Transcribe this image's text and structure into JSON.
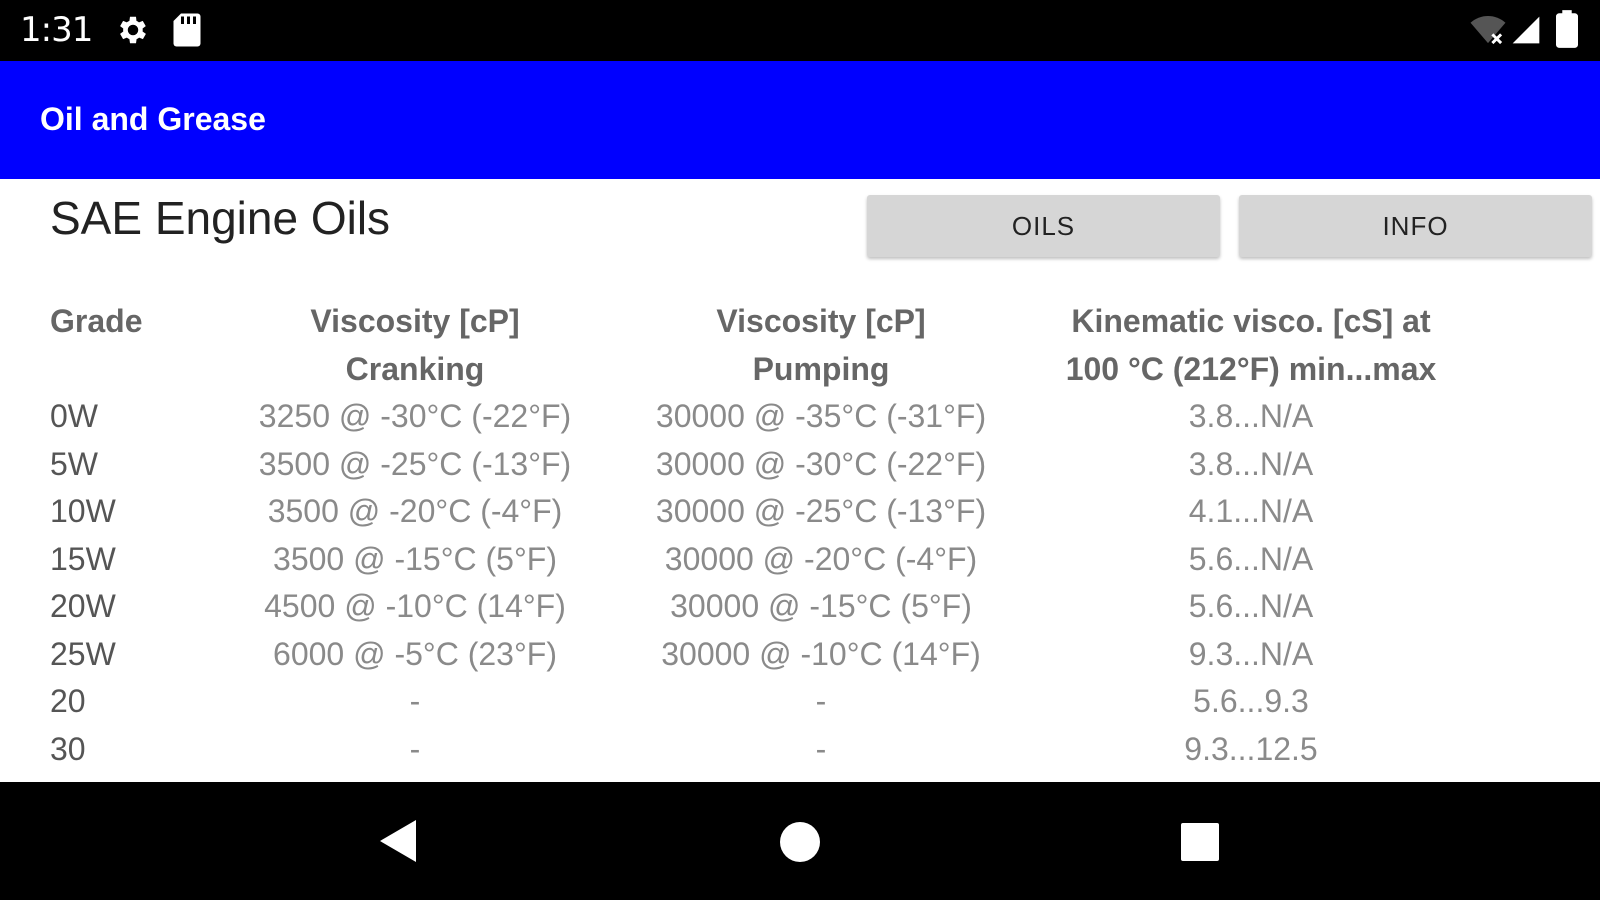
{
  "status_bar": {
    "time": "1:31",
    "icons": [
      "gear-icon",
      "sd-card-icon",
      "wifi-off-icon",
      "signal-icon",
      "battery-icon"
    ]
  },
  "app_bar": {
    "title": "Oil and Grease",
    "color": "#0000ff"
  },
  "page": {
    "title": "SAE Engine Oils",
    "buttons": {
      "oils": "OILS",
      "info": "INFO"
    }
  },
  "table": {
    "headers": {
      "grade": "Grade",
      "cranking_line1": "Viscosity [cP]",
      "cranking_line2": "Cranking",
      "pumping_line1": "Viscosity [cP]",
      "pumping_line2": "Pumping",
      "kinematic_line1": "Kinematic visco. [cS] at",
      "kinematic_line2": "100 °C (212°F) min...max"
    },
    "rows": [
      [
        "0W",
        "3250 @ -30°C (-22°F)",
        "30000 @ -35°C (-31°F)",
        "3.8...N/A"
      ],
      [
        "5W",
        "3500 @ -25°C (-13°F)",
        "30000 @ -30°C (-22°F)",
        "3.8...N/A"
      ],
      [
        "10W",
        "3500 @ -20°C (-4°F)",
        "30000 @ -25°C (-13°F)",
        "4.1...N/A"
      ],
      [
        "15W",
        "3500 @ -15°C (5°F)",
        "30000 @ -20°C (-4°F)",
        "5.6...N/A"
      ],
      [
        "20W",
        "4500 @ -10°C (14°F)",
        "30000 @ -15°C (5°F)",
        "5.6...N/A"
      ],
      [
        "25W",
        "6000 @ -5°C (23°F)",
        "30000 @ -10°C (14°F)",
        "9.3...N/A"
      ],
      [
        "20",
        "-",
        "-",
        "5.6...9.3"
      ],
      [
        "30",
        "-",
        "-",
        "9.3...12.5"
      ]
    ]
  },
  "nav_bar": {
    "icons": [
      "back-icon",
      "home-icon",
      "recents-icon"
    ]
  }
}
